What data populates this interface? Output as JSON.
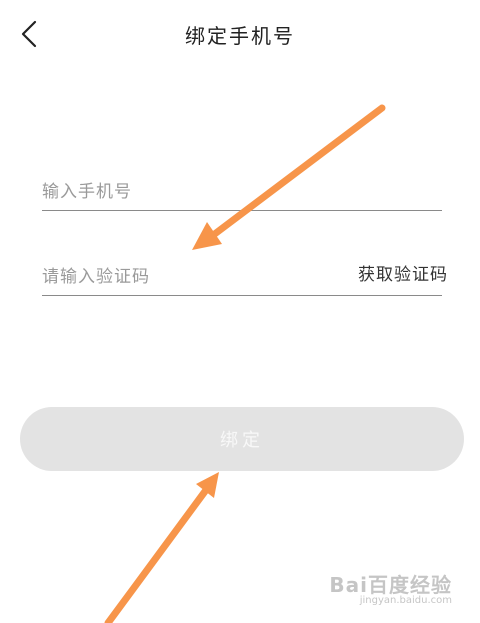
{
  "header": {
    "title": "绑定手机号",
    "back_icon": "chevron-left-icon"
  },
  "form": {
    "phone_placeholder": "输入手机号",
    "code_placeholder": "请输入验证码",
    "get_code_label": "获取验证码",
    "submit_label": "绑定"
  },
  "annotations": {
    "arrow_color": "#f7954a"
  },
  "watermark": {
    "brand": "Bai百度经验",
    "url": "jingyan.baidu.com"
  }
}
